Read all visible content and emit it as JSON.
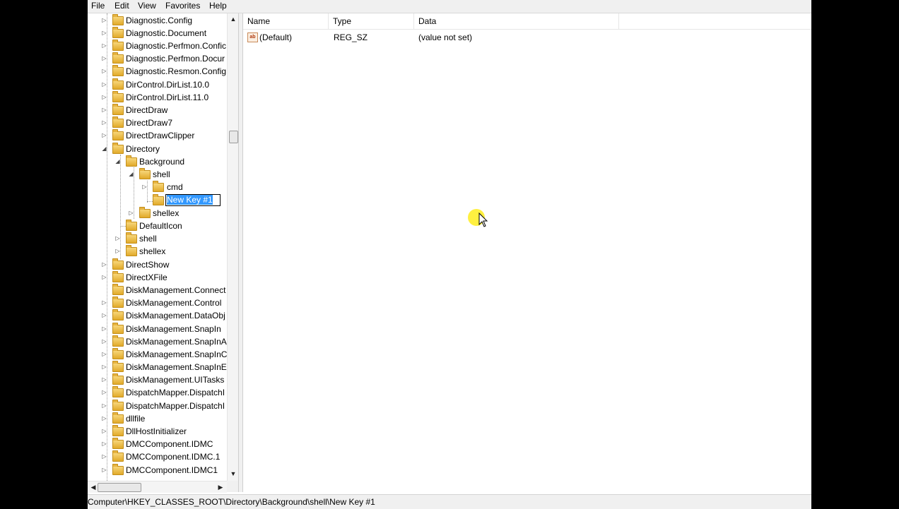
{
  "menu": {
    "file": "File",
    "edit": "Edit",
    "view": "View",
    "favorites": "Favorites",
    "help": "Help"
  },
  "tree": {
    "items": [
      {
        "label": "Diagnostic.Config"
      },
      {
        "label": "Diagnostic.Document"
      },
      {
        "label": "Diagnostic.Perfmon.Confic"
      },
      {
        "label": "Diagnostic.Perfmon.Docur"
      },
      {
        "label": "Diagnostic.Resmon.Config"
      },
      {
        "label": "DirControl.DirList.10.0"
      },
      {
        "label": "DirControl.DirList.11.0"
      },
      {
        "label": "DirectDraw"
      },
      {
        "label": "DirectDraw7"
      },
      {
        "label": "DirectDrawClipper"
      },
      {
        "label": "Directory"
      },
      {
        "label": "Background"
      },
      {
        "label": "shell"
      },
      {
        "label": "cmd"
      },
      {
        "label": "New Key #1"
      },
      {
        "label": "shellex"
      },
      {
        "label": "DefaultIcon"
      },
      {
        "label": "shell"
      },
      {
        "label": "shellex"
      },
      {
        "label": "DirectShow"
      },
      {
        "label": "DirectXFile"
      },
      {
        "label": "DiskManagement.Connect"
      },
      {
        "label": "DiskManagement.Control"
      },
      {
        "label": "DiskManagement.DataObj"
      },
      {
        "label": "DiskManagement.SnapIn"
      },
      {
        "label": "DiskManagement.SnapInA"
      },
      {
        "label": "DiskManagement.SnapInC"
      },
      {
        "label": "DiskManagement.SnapInE"
      },
      {
        "label": "DiskManagement.UITasks"
      },
      {
        "label": "DispatchMapper.DispatchI"
      },
      {
        "label": "DispatchMapper.DispatchI"
      },
      {
        "label": "dllfile"
      },
      {
        "label": "DllHostInitializer"
      },
      {
        "label": "DMCComponent.IDMC"
      },
      {
        "label": "DMCComponent.IDMC.1"
      },
      {
        "label": "DMCComponent.IDMC1"
      }
    ]
  },
  "values": {
    "headers": {
      "name": "Name",
      "type": "Type",
      "data": "Data"
    },
    "rows": [
      {
        "name": "(Default)",
        "type": "REG_SZ",
        "data": "(value not set)",
        "icon": "string-value-icon"
      }
    ]
  },
  "statusbar": {
    "path": "Computer\\HKEY_CLASSES_ROOT\\Directory\\Background\\shell\\New Key #1"
  }
}
